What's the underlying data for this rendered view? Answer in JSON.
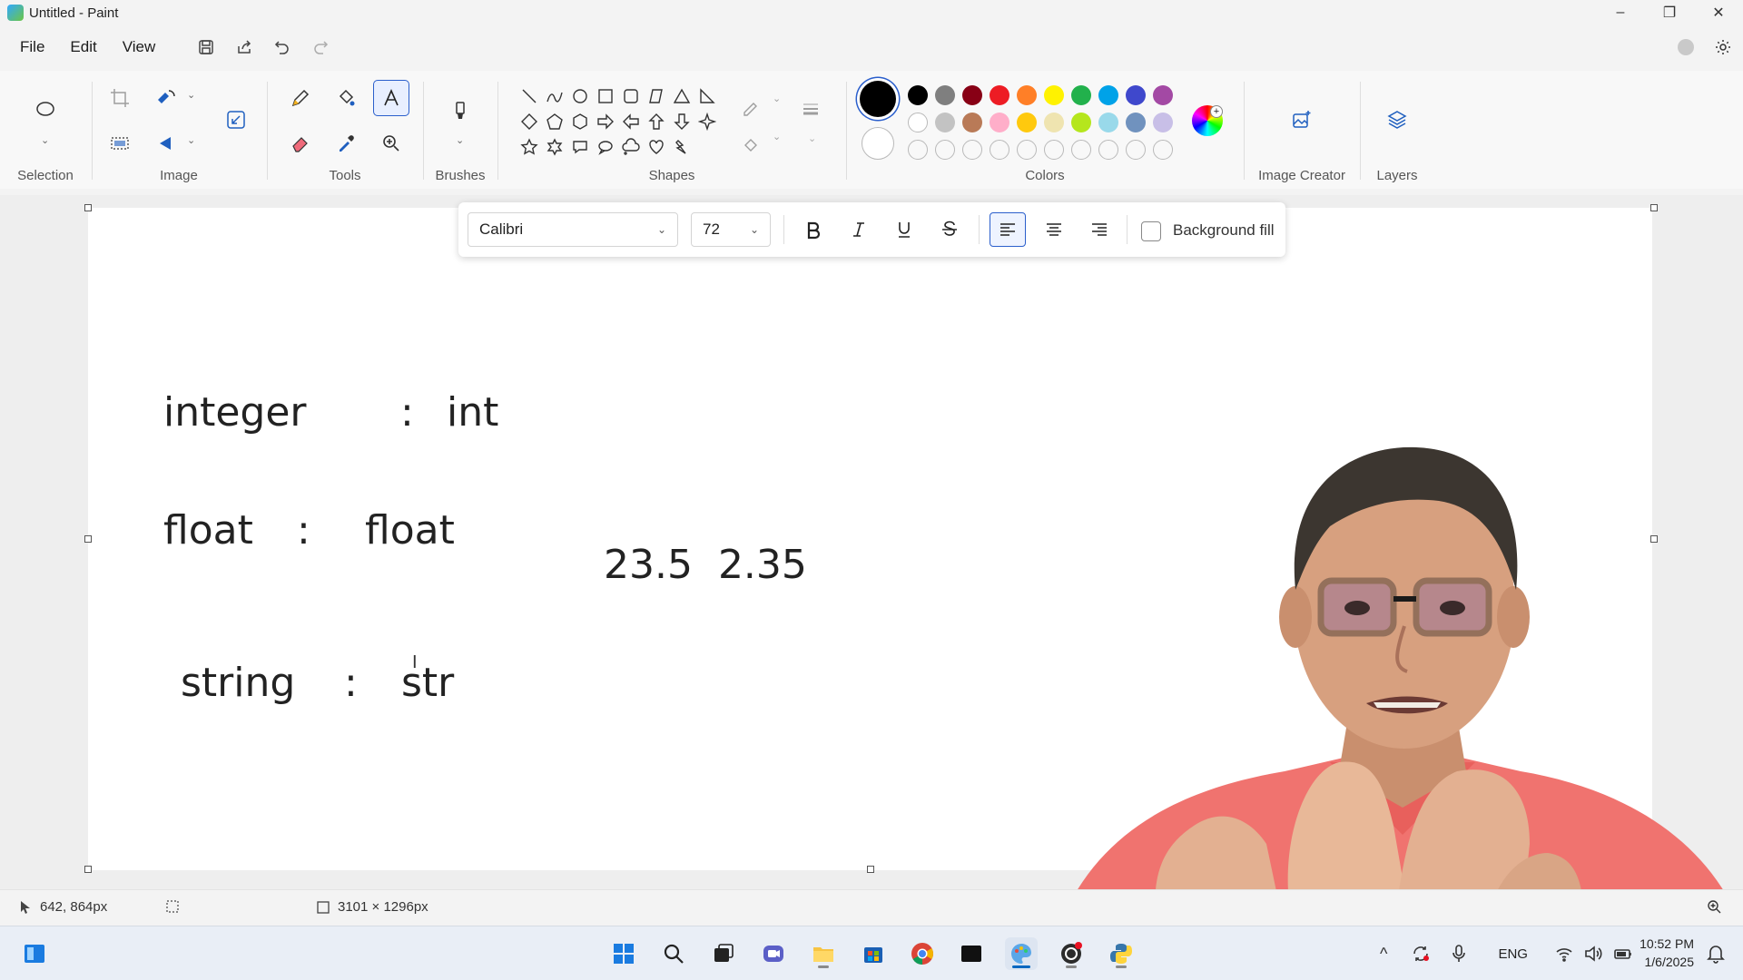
{
  "window": {
    "title": "Untitled - Paint",
    "controls": [
      "–",
      "❐",
      "✕"
    ]
  },
  "menu": {
    "items": [
      "File",
      "Edit",
      "View"
    ]
  },
  "ribbon": {
    "groups": {
      "selection": "Selection",
      "image": "Image",
      "tools": "Tools",
      "brushes": "Brushes",
      "shapes": "Shapes",
      "colors": "Colors",
      "image_creator": "Image Creator",
      "layers": "Layers"
    },
    "colors": {
      "primary": "#000000",
      "secondary": "#ffffff",
      "row1": [
        "#000000",
        "#7f7f7f",
        "#880015",
        "#ed1c24",
        "#ff7f27",
        "#fff200",
        "#22b14c",
        "#00a2e8",
        "#3f48cc",
        "#a349a4"
      ],
      "row2": [
        "#ffffff",
        "#c3c3c3",
        "#b97a57",
        "#ffaec9",
        "#ffc90e",
        "#efe4b0",
        "#b5e61d",
        "#99d9ea",
        "#7092be",
        "#c8bfe7"
      ]
    }
  },
  "text_toolbar": {
    "font": "Calibri",
    "size": "72",
    "background_fill_label": "Background fill"
  },
  "canvas": {
    "lines": [
      {
        "left": "integer",
        "sep": ":",
        "right": "int"
      },
      {
        "left": "float",
        "sep": ":",
        "right": "float"
      },
      {
        "left": "string",
        "sep": ":",
        "right": "str"
      }
    ],
    "numbers": "23.5  2.35"
  },
  "status": {
    "cursor": "642, 864px",
    "canvas_size": "3101 × 1296px"
  },
  "taskbar": {
    "language": "ENG",
    "time": "10:52 PM",
    "date": "1/6/2025"
  }
}
